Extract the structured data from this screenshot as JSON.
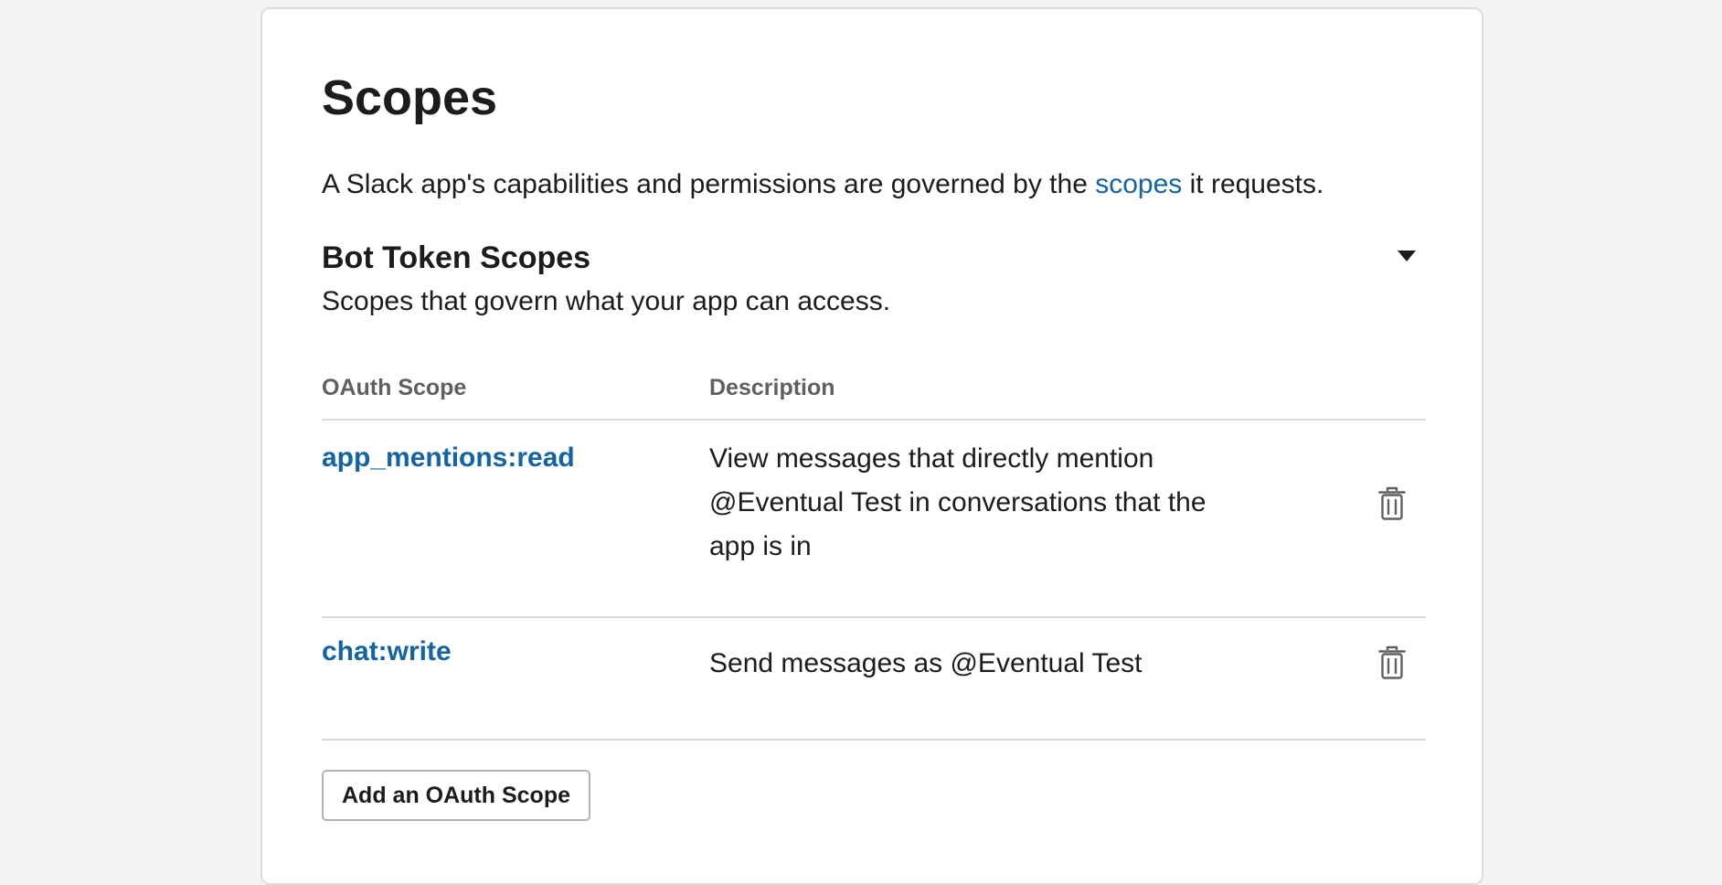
{
  "page": {
    "title": "Scopes",
    "intro_before": "A Slack app's capabilities and permissions are governed by the ",
    "intro_link": "scopes",
    "intro_after": " it requests."
  },
  "bot_token_scopes": {
    "title": "Bot Token Scopes",
    "subtitle": "Scopes that govern what your app can access.",
    "columns": {
      "scope": "OAuth Scope",
      "description": "Description"
    },
    "rows": [
      {
        "scope": "app_mentions:read",
        "description": "View messages that directly mention @Eventual Test in conversations that the app is in",
        "action_icon": "trash-icon"
      },
      {
        "scope": "chat:write",
        "description": "Send messages as @Eventual Test",
        "action_icon": "trash-icon"
      }
    ],
    "add_button_label": "Add an OAuth Scope",
    "collapse_icon": "caret-down-icon"
  },
  "colors": {
    "link": "#1264a3",
    "text": "#1d1c1d",
    "muted": "#616061",
    "border": "#dddddd",
    "background": "#f4f4f4"
  }
}
